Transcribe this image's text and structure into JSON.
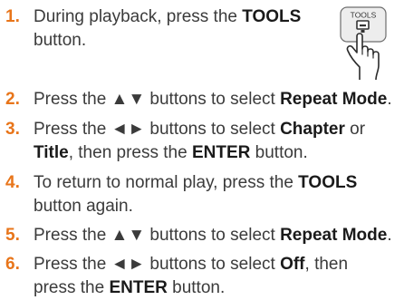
{
  "steps": [
    {
      "num": "1.",
      "line1": [
        "During playback, press the ",
        "TOOLS"
      ],
      "line2": [
        "button."
      ]
    },
    {
      "num": "2.",
      "line1": [
        "Press the ▲▼ buttons to select ",
        "Repeat Mode",
        "."
      ]
    },
    {
      "num": "3.",
      "line1": [
        "Press the ◄► buttons to select ",
        "Chapter",
        " or"
      ],
      "line2": [
        "Title",
        ", then press the ",
        "ENTER",
        " button."
      ]
    },
    {
      "num": "4.",
      "line1": [
        "To return to normal play, press the ",
        "TOOLS"
      ],
      "line2": [
        "button again."
      ]
    },
    {
      "num": "5.",
      "line1": [
        "Press the ▲▼ buttons to select ",
        "Repeat Mode",
        "."
      ]
    },
    {
      "num": "6.",
      "line1": [
        "Press the ◄► buttons to select ",
        "Off",
        ", then"
      ],
      "line2": [
        "press the ",
        "ENTER",
        " button."
      ]
    }
  ],
  "remote_illustration": {
    "label": "TOOLS",
    "icon": "hand-pressing-tools-button-icon"
  },
  "colors": {
    "step_number": "#e8751a",
    "body_text": "#3b3b3b",
    "emphasis": "#1a1a1a"
  }
}
